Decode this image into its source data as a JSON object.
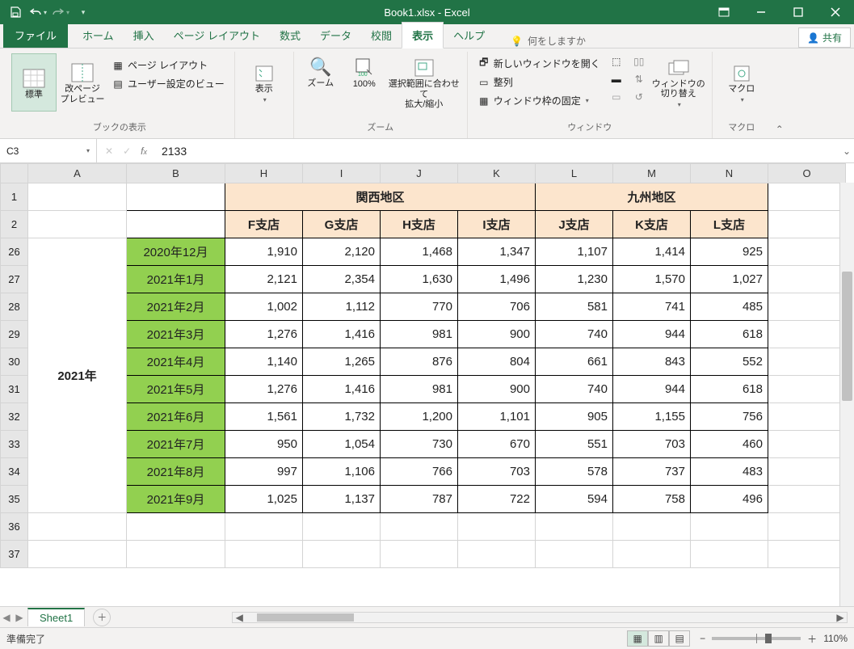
{
  "title": "Book1.xlsx  -  Excel",
  "tabs": {
    "file": "ファイル",
    "home": "ホーム",
    "insert": "挿入",
    "layout": "ページ レイアウト",
    "formulas": "数式",
    "data": "データ",
    "review": "校閲",
    "view": "表示",
    "help": "ヘルプ"
  },
  "tellme": "何をしますか",
  "share": "共有",
  "ribbon": {
    "book_view": {
      "normal": "標準",
      "page_break": "改ページ\nプレビュー",
      "page_layout": "ページ レイアウト",
      "custom": "ユーザー設定のビュー",
      "label": "ブックの表示"
    },
    "show": {
      "btn": "表示",
      "label": ""
    },
    "zoom": {
      "zoom": "ズーム",
      "p100": "100%",
      "sel": "選択範囲に合わせて\n拡大/縮小",
      "label": "ズーム"
    },
    "window": {
      "newwin": "新しいウィンドウを開く",
      "arrange": "整列",
      "freeze": "ウィンドウ枠の固定",
      "switch": "ウィンドウの\n切り替え",
      "label": "ウィンドウ"
    },
    "macro": {
      "btn": "マクロ",
      "label": "マクロ"
    }
  },
  "namebox": "C3",
  "formula": "2133",
  "columns": [
    "",
    "A",
    "B",
    "H",
    "I",
    "J",
    "K",
    "L",
    "M",
    "N",
    "O"
  ],
  "regions": {
    "kansai": "関西地区",
    "kyushu": "九州地区"
  },
  "branches": {
    "f": "F支店",
    "g": "G支店",
    "h": "H支店",
    "i": "I支店",
    "j": "J支店",
    "k": "K支店",
    "l": "L支店"
  },
  "year_label": "2021年",
  "row_headers": [
    "1",
    "2",
    "26",
    "27",
    "28",
    "29",
    "30",
    "31",
    "32",
    "33",
    "34",
    "35",
    "36",
    "37"
  ],
  "rows": [
    {
      "month": "2020年12月",
      "v": [
        "1,910",
        "2,120",
        "1,468",
        "1,347",
        "1,107",
        "1,414",
        "925"
      ]
    },
    {
      "month": "2021年1月",
      "v": [
        "2,121",
        "2,354",
        "1,630",
        "1,496",
        "1,230",
        "1,570",
        "1,027"
      ]
    },
    {
      "month": "2021年2月",
      "v": [
        "1,002",
        "1,112",
        "770",
        "706",
        "581",
        "741",
        "485"
      ]
    },
    {
      "month": "2021年3月",
      "v": [
        "1,276",
        "1,416",
        "981",
        "900",
        "740",
        "944",
        "618"
      ]
    },
    {
      "month": "2021年4月",
      "v": [
        "1,140",
        "1,265",
        "876",
        "804",
        "661",
        "843",
        "552"
      ]
    },
    {
      "month": "2021年5月",
      "v": [
        "1,276",
        "1,416",
        "981",
        "900",
        "740",
        "944",
        "618"
      ]
    },
    {
      "month": "2021年6月",
      "v": [
        "1,561",
        "1,732",
        "1,200",
        "1,101",
        "905",
        "1,155",
        "756"
      ]
    },
    {
      "month": "2021年7月",
      "v": [
        "950",
        "1,054",
        "730",
        "670",
        "551",
        "703",
        "460"
      ]
    },
    {
      "month": "2021年8月",
      "v": [
        "997",
        "1,106",
        "766",
        "703",
        "578",
        "737",
        "483"
      ]
    },
    {
      "month": "2021年9月",
      "v": [
        "1,025",
        "1,137",
        "787",
        "722",
        "594",
        "758",
        "496"
      ]
    }
  ],
  "sheet_tab": "Sheet1",
  "status": "準備完了",
  "zoom_pct": "110%"
}
